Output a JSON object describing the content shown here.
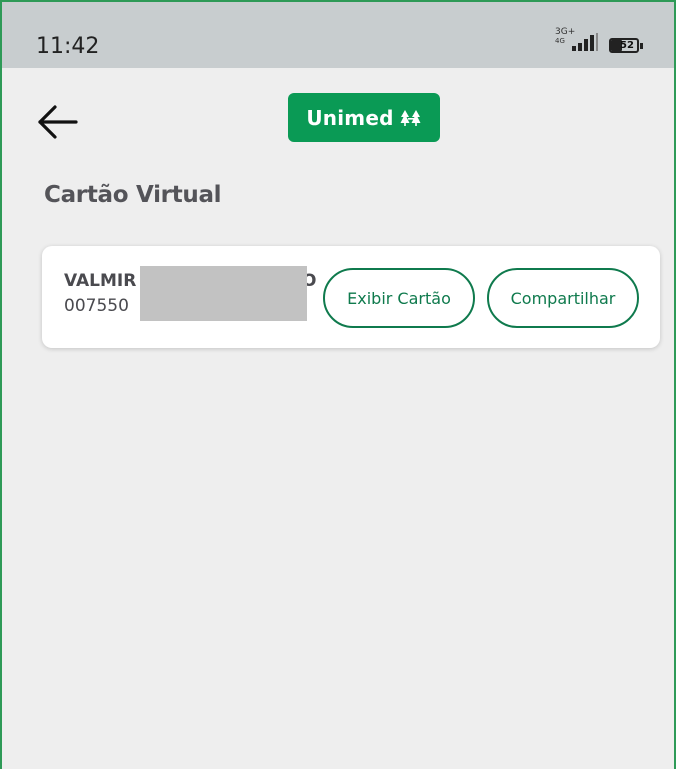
{
  "status_bar": {
    "time": "11:42",
    "network_top": "3G+",
    "network_bottom": "4G",
    "battery": "52"
  },
  "header": {
    "back_icon": "arrow-left-icon",
    "logo_text": "Unimed",
    "logo_mark": "unimed-trees-icon",
    "brand_color": "#0a9a55"
  },
  "page": {
    "title": "Cartão Virtual"
  },
  "card": {
    "holder_name_visible": "VALMIR",
    "holder_name_tail": "O",
    "card_number_visible": "007550",
    "view_button": "Exibir Cartão",
    "share_button": "Compartilhar",
    "accent_color": "#0f7a4d"
  }
}
